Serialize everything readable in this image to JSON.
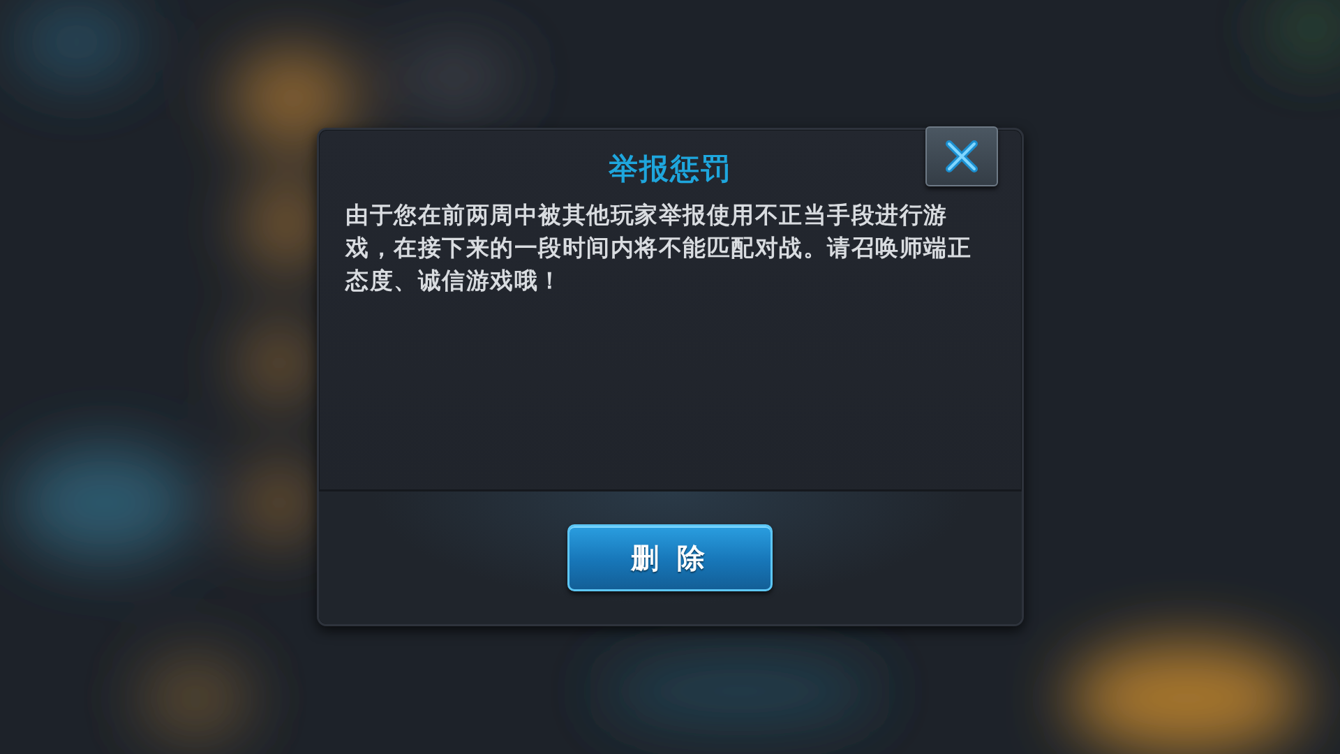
{
  "dialog": {
    "title": "举报惩罚",
    "message": "由于您在前两周中被其他玩家举报使用不正当手段进行游戏，在接下来的一段时间内将不能匹配对战。请召唤师端正态度、诚信游戏哦！",
    "button": {
      "label": "删 除"
    }
  }
}
